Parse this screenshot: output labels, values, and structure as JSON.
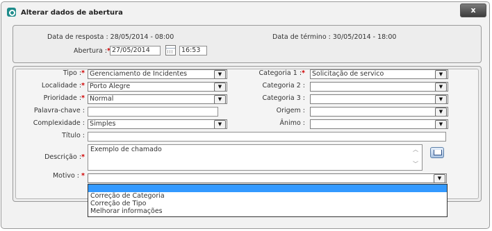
{
  "window": {
    "title": "Alterar dados de abertura",
    "close_label": "x"
  },
  "header": {
    "data_resposta": "Data de resposta : 28/05/2014 - 08:00",
    "data_termino": "Data de término : 30/05/2014 - 18:00",
    "abertura_label": "Abertura :",
    "abertura_date": "27/05/2014",
    "abertura_time": "16:53"
  },
  "form": {
    "tipo": {
      "label": "Tipo :",
      "value": "Gerenciamento de Incidentes"
    },
    "localidade": {
      "label": "Localidade :",
      "value": "Porto Alegre"
    },
    "prioridade": {
      "label": "Prioridade :",
      "value": "Normal"
    },
    "palavra_chave": {
      "label": "Palavra-chave :",
      "value": ""
    },
    "complexidade": {
      "label": "Complexidade :",
      "value": "Simples"
    },
    "titulo": {
      "label": "Título :",
      "value": ""
    },
    "descricao": {
      "label": "Descrição :",
      "value": "Exemplo de chamado"
    },
    "motivo": {
      "label": "Motivo :",
      "value": ""
    },
    "categoria1": {
      "label": "Categoria 1 :",
      "value": "Solicitação de servico"
    },
    "categoria2": {
      "label": "Categoria 2 :",
      "value": ""
    },
    "categoria3": {
      "label": "Categoria 3 :",
      "value": ""
    },
    "origem": {
      "label": "Origem :",
      "value": ""
    },
    "animo": {
      "label": "Ânimo :",
      "value": ""
    }
  },
  "required_mark": "*",
  "motivo_options": [
    "",
    "Correção de Categoria",
    "Correção de Tipo",
    "Melhorar informações"
  ],
  "icons": {
    "app": "app-logo-icon",
    "calendar": "calendar-icon",
    "dictionary": "book-icon",
    "dropdown": "chevron-down-icon"
  }
}
